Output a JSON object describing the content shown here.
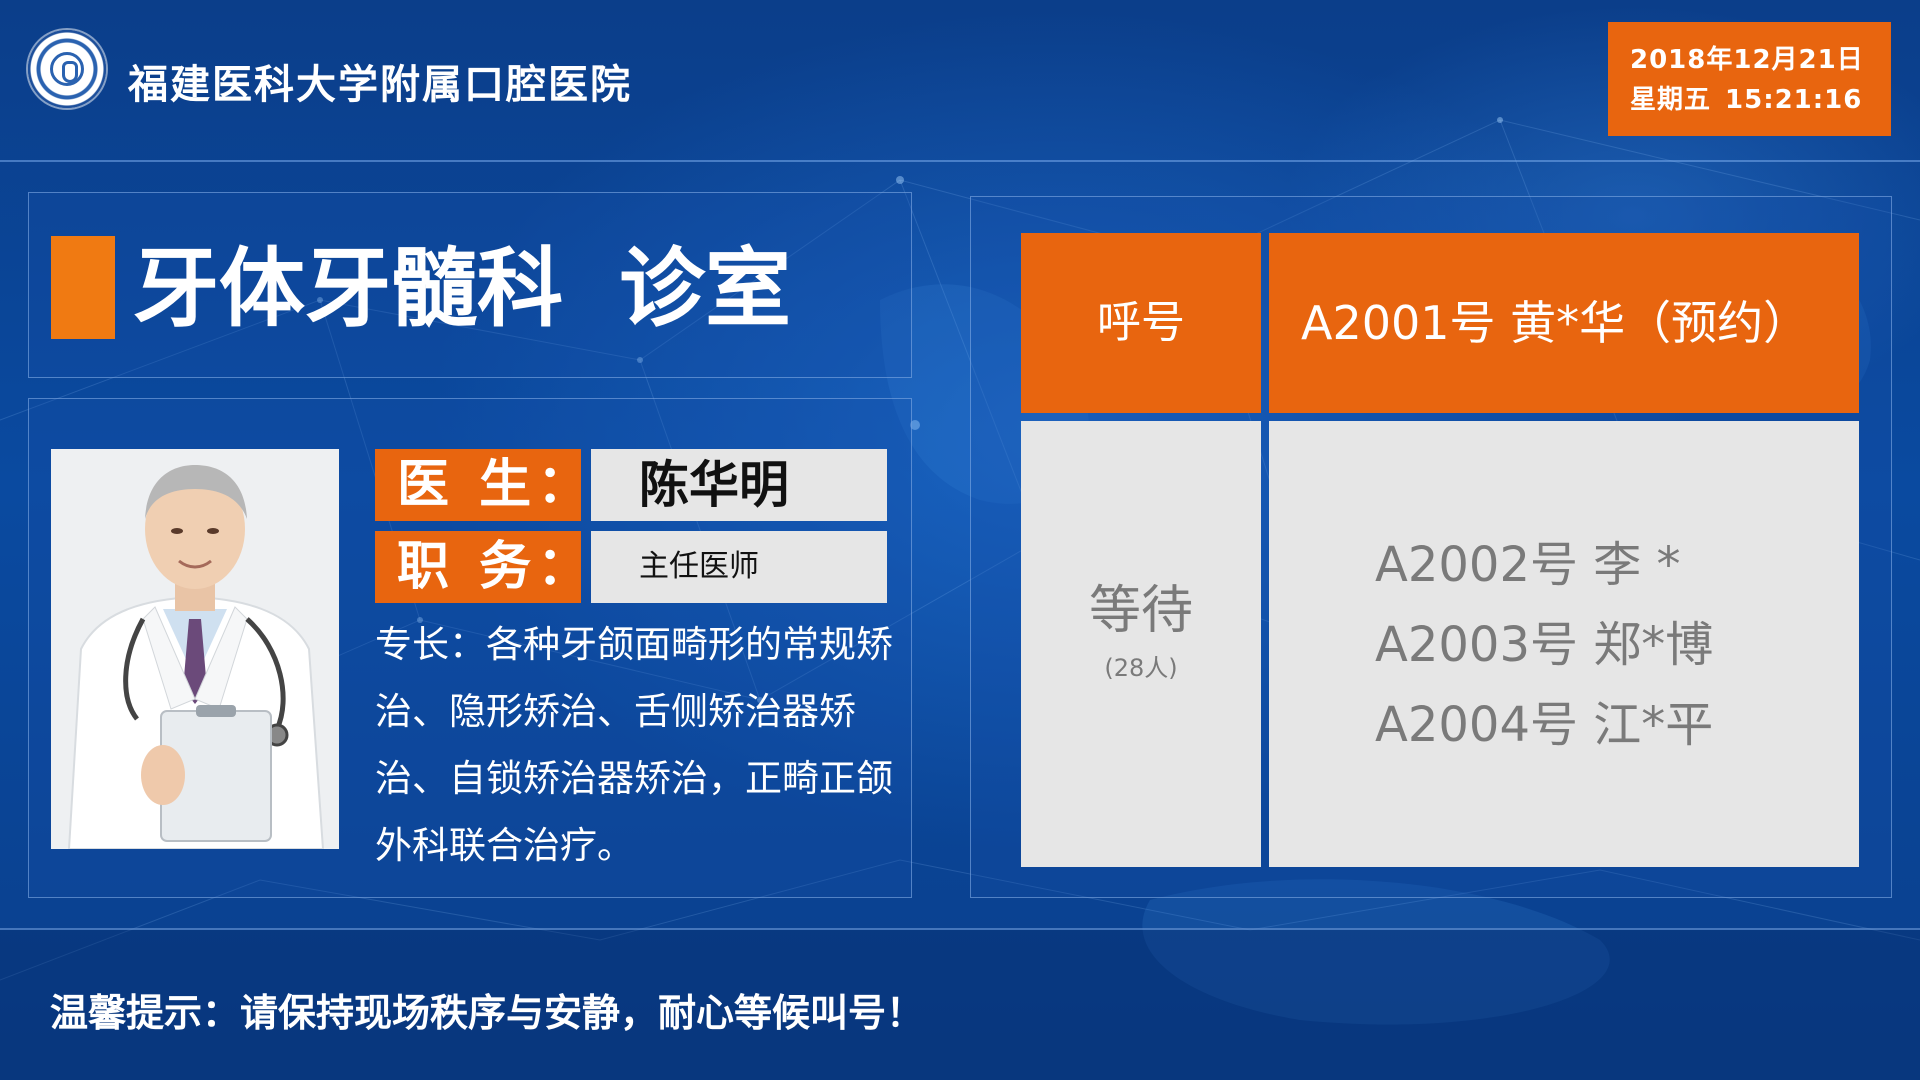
{
  "header": {
    "hospital_name": "福建医科大学附属口腔医院",
    "date": "2018年12月21日",
    "weekday": "星期五",
    "time": "15:21:16"
  },
  "department": {
    "name": "牙体牙髓科",
    "room": "诊室"
  },
  "doctor": {
    "name_label": "医 生：",
    "name": "陈华明",
    "title_label": "职 务：",
    "title": "主任医师",
    "specialty": "专长：各种牙颌面畸形的常规矫治、隐形矫治、舌侧矫治器矫治、自锁矫治器矫治，正畸正颌外科联合治疗。"
  },
  "queue": {
    "call_label": "呼号",
    "current": "A2001号 黄*华（预约）",
    "waiting_label": "等待",
    "waiting_count": "(28人)",
    "waiting_list": [
      "A2002号  李 *",
      "A2003号  郑*博",
      "A2004号  江*平"
    ]
  },
  "footer": {
    "tip": "温馨提示：请保持现场秩序与安静，耐心等候叫号！"
  },
  "colors": {
    "accent": "#e8650f",
    "background": "#0b449a",
    "panel_light": "#e6e6e6"
  }
}
